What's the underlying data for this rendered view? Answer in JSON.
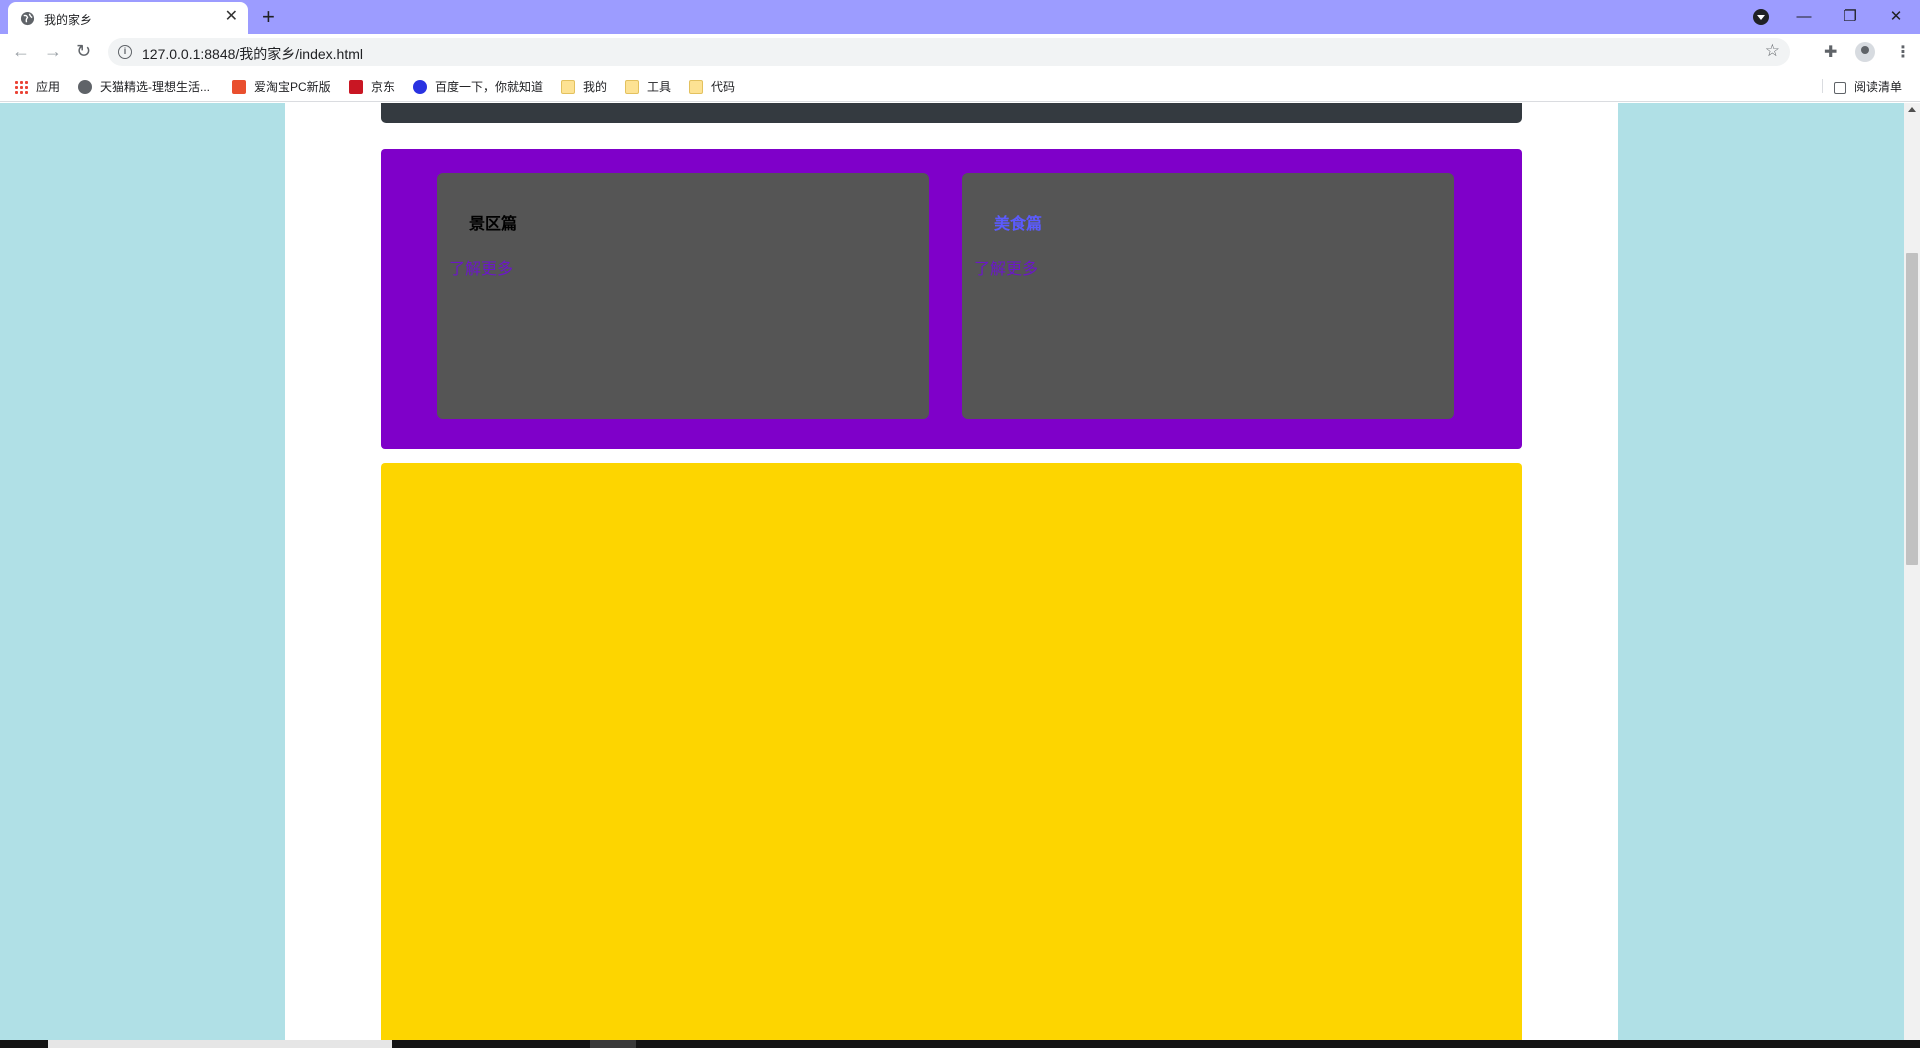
{
  "browser": {
    "tab_title": "我的家乡",
    "tab_close": "✕",
    "new_tab": "+",
    "url": "127.0.0.1:8848/我的家乡/index.html",
    "window_controls": {
      "minimize": "—",
      "restore": "❐",
      "close": "✕"
    },
    "nav": {
      "back": "←",
      "forward": "→",
      "reload": "↻"
    },
    "bookmarks": [
      {
        "label": "应用",
        "icon": "apps-icon"
      },
      {
        "label": "天猫精选-理想生活...",
        "icon": "globe-icon"
      },
      {
        "label": "爱淘宝PC新版",
        "icon": "aitaobao-icon",
        "color": "#e94f2e"
      },
      {
        "label": "京东",
        "icon": "jd-icon",
        "color": "#c91623"
      },
      {
        "label": "百度一下，你就知道",
        "icon": "baidu-icon",
        "color": "#2932e1"
      },
      {
        "label": "我的",
        "icon": "folder-icon"
      },
      {
        "label": "工具",
        "icon": "folder-icon"
      },
      {
        "label": "代码",
        "icon": "folder-icon"
      }
    ],
    "reading_list": "阅读清单"
  },
  "page": {
    "colors": {
      "background": "#b0e0e6",
      "container": "#ffffff",
      "top_bar": "#343a40",
      "purple_section": "#7f00c9",
      "card": "#555555",
      "yellow_section": "#fdd500"
    },
    "cards": [
      {
        "title": "景区篇",
        "title_color": "#000000",
        "link": "了解更多"
      },
      {
        "title": "美食篇",
        "title_color": "#5b5bff",
        "link": "了解更多"
      }
    ]
  }
}
